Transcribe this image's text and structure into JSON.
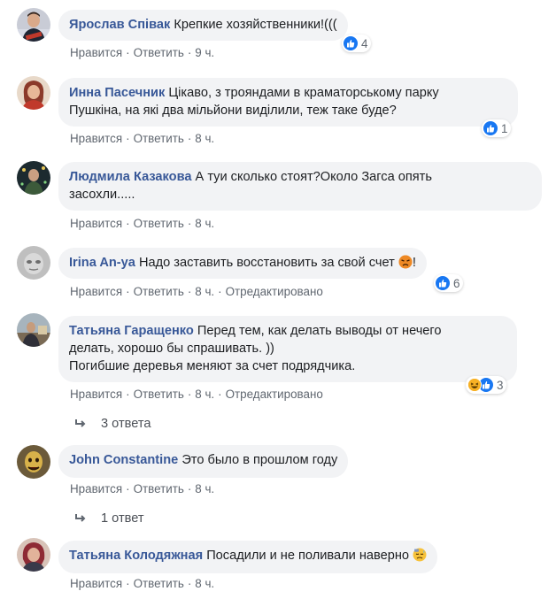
{
  "comments": [
    {
      "author": "Ярослав Співак",
      "text": "Крепкие хозяйственники!(((",
      "like": "Нравится",
      "reply": "Ответить",
      "time": "9 ч.",
      "reactions": "4"
    },
    {
      "author": "Инна Пасечник",
      "text": "Цікаво, з трояндами в краматорському парку",
      "text2": "Пушкіна, на які два мільйони виділили, теж таке буде?",
      "like": "Нравится",
      "reply": "Ответить",
      "time": "8 ч.",
      "reactions": "1"
    },
    {
      "author": "Людмила Казакова",
      "text": "А туи сколько стоят?Около Загса опять",
      "text2": "засохли.....",
      "like": "Нравится",
      "reply": "Ответить",
      "time": "8 ч."
    },
    {
      "author": "Irina An-ya",
      "text": "Надо заставить восстановить за свой счет",
      "text_end": "!",
      "like": "Нравится",
      "reply": "Ответить",
      "time": "8 ч.",
      "edited": "Отредактировано",
      "reactions": "6"
    },
    {
      "author": "Татьяна Гаращенко",
      "text": "Перед тем, как делать выводы от нечего",
      "text2": "делать, хорошо бы спрашивать. ))",
      "text3": "Погибшие деревья меняют за счет подрядчика.",
      "like": "Нравится",
      "reply": "Ответить",
      "time": "8 ч.",
      "edited": "Отредактировано",
      "reactions": "3"
    },
    {
      "author": "John Constantine",
      "text": "Это было в прошлом году",
      "like": "Нравится",
      "reply": "Ответить",
      "time": "8 ч."
    },
    {
      "author": "Татьяна Колодяжная",
      "text": "Посадили и не поливали наверно",
      "like": "Нравится",
      "reply": "Ответить",
      "time": "8 ч."
    }
  ],
  "replies": [
    {
      "label": "3 ответа"
    },
    {
      "label": "1 ответ"
    }
  ],
  "separator": "·",
  "colors": {
    "author": "#385898",
    "bubble": "#f2f3f5",
    "like": "#1877f2",
    "meta": "#606770"
  }
}
